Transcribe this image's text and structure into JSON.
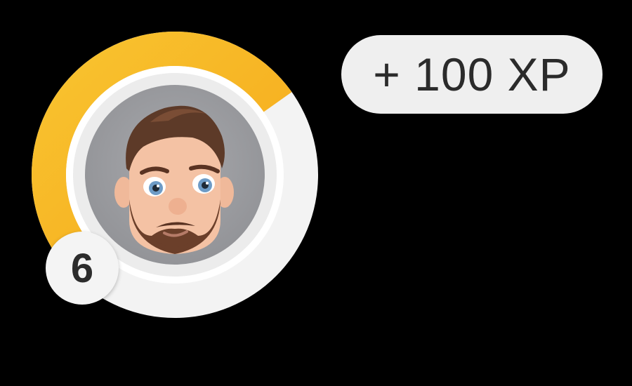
{
  "profile": {
    "level": "6",
    "xp_progress_fraction": 0.62,
    "avatar_icon": "memoji-avatar-icon"
  },
  "reward": {
    "xp_label": "+ 100 XP"
  },
  "colors": {
    "progress": "#f6b21b",
    "progress_highlight": "#f8c531",
    "ring_track": "#f3f3f3",
    "avatar_bg": "#9d9ea2",
    "background": "#000000"
  }
}
